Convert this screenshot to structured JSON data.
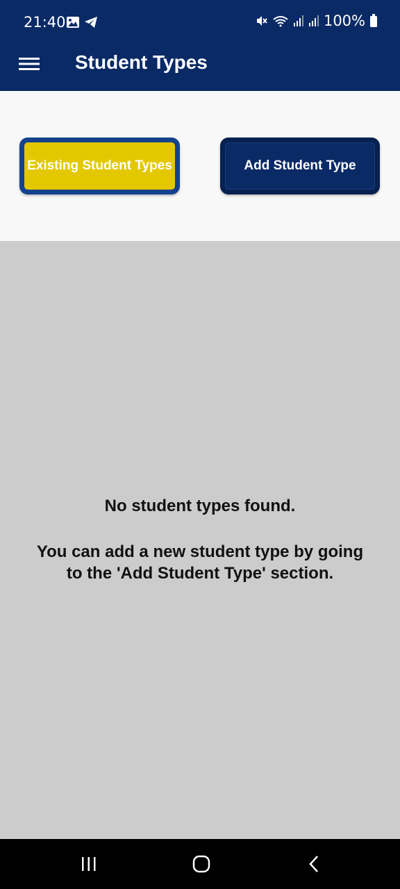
{
  "status_bar": {
    "time": "21:40",
    "battery": "100%",
    "left_icons": [
      "image-icon",
      "telegram-icon"
    ],
    "right_icons": [
      "mute-icon",
      "wifi-icon",
      "signal-icon",
      "signal-icon",
      "battery-icon"
    ]
  },
  "app_bar": {
    "title": "Student Types",
    "menu_icon": "hamburger-menu-icon"
  },
  "tabs": {
    "existing_label": "Existing Student Types",
    "add_label": "Add Student Type"
  },
  "empty_state": {
    "title": "No student types found.",
    "description": "You can add a new student type by going to the 'Add Student Type' section."
  },
  "nav_bar": {
    "icons": [
      "recents-icon",
      "home-icon",
      "back-icon"
    ]
  },
  "colors": {
    "primary": "#0a2a66",
    "accent": "#e3c800",
    "border": "#14428c",
    "content_bg": "#cccccc"
  }
}
